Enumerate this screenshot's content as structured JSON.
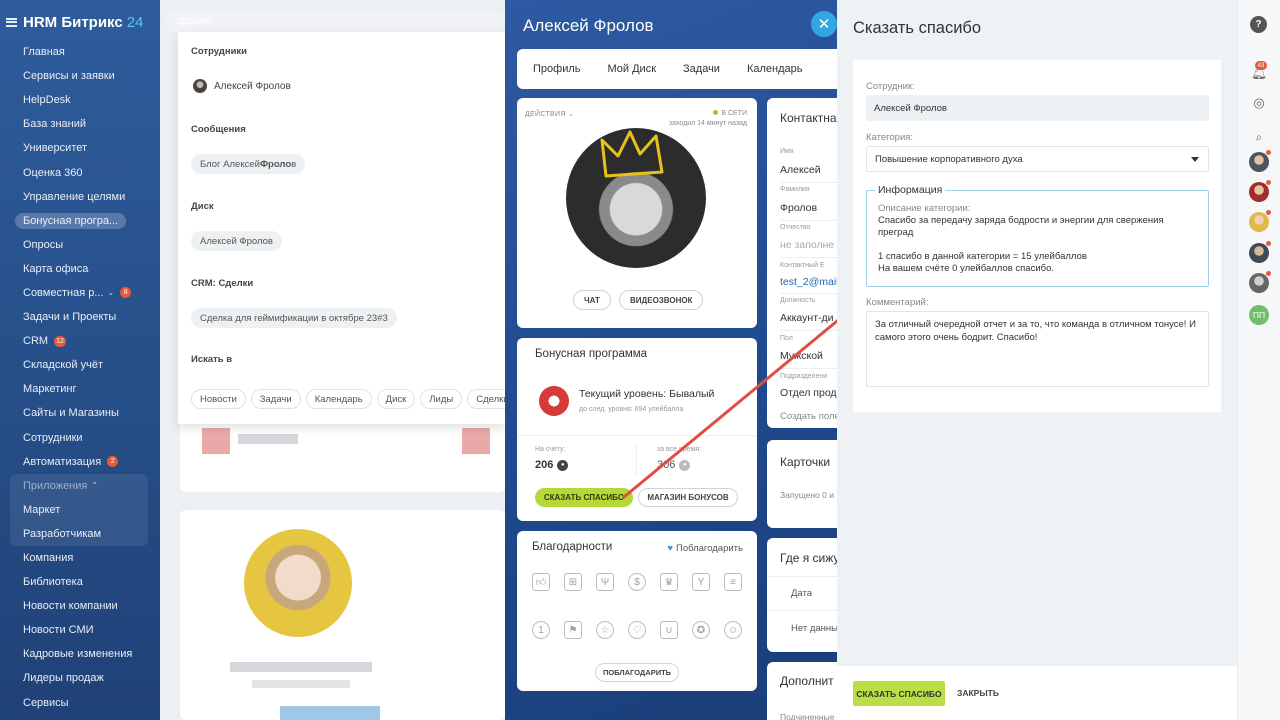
{
  "sidebar": {
    "logo": "HRM Битрикс",
    "logo_num": "24",
    "items": [
      {
        "label": "Главная"
      },
      {
        "label": "Сервисы и заявки"
      },
      {
        "label": "HelpDesk"
      },
      {
        "label": "База знаний"
      },
      {
        "label": "Университет"
      },
      {
        "label": "Оценка 360"
      },
      {
        "label": "Управление целями"
      },
      {
        "label": "Бонусная програ..."
      },
      {
        "label": "Опросы"
      },
      {
        "label": "Карта офиса"
      },
      {
        "label": "Совместная р...",
        "badge": "8"
      },
      {
        "label": "Задачи и Проекты"
      },
      {
        "label": "CRM",
        "badge": "12"
      },
      {
        "label": "Складской учёт"
      },
      {
        "label": "Маркетинг"
      },
      {
        "label": "Сайты и Магазины"
      },
      {
        "label": "Сотрудники"
      },
      {
        "label": "Автоматизация",
        "badge": "2"
      }
    ],
    "apps": {
      "label": "Приложения",
      "items": [
        "Маркет",
        "Разработчикам"
      ]
    },
    "items2": [
      "Компания",
      "Библиотека",
      "Новости компании",
      "Новости СМИ",
      "Кадровые изменения",
      "Лидеры продаж",
      "Сервисы"
    ]
  },
  "search": {
    "query": "фроло",
    "sec_employees": "Сотрудники",
    "employee": "Алексей Фролов",
    "sec_messages": "Сообщения",
    "blog_prefix": "Блог Алексей ",
    "blog_bold": "Фроло",
    "blog_suffix": "в",
    "sec_disk": "Диск",
    "disk_item": "Алексей Фролов",
    "sec_crm": "CRM: Сделки",
    "crm_item": "Сделка для геймификации в октябре 23#3",
    "sec_search_in": "Искать в",
    "scopes": [
      "Новости",
      "Задачи",
      "Календарь",
      "Диск",
      "Лиды",
      "Сделки"
    ]
  },
  "profile": {
    "name": "Алексей Фролов",
    "tabs": [
      "Профиль",
      "Мой Диск",
      "Задачи",
      "Календарь"
    ],
    "actions_label": "ДЕЙСТВИЯ",
    "online": "В СЕТИ",
    "last_seen": "заходил 14 минут назад",
    "chat_btn": "ЧАТ",
    "video_btn": "ВИДЕОЗВОНОК",
    "bonus": {
      "title": "Бонусная программа",
      "level": "Текущий уровень: Бывалый",
      "next": "до след. уровня: 694 улейбалла",
      "account_label": "На счету:",
      "account_value": "206",
      "total_label": "за все время:",
      "total_value": "306",
      "thanks_btn": "СКАЗАТЬ СПАСИБО",
      "shop_btn": "МАГАЗИН БОНУСОВ"
    },
    "gratitude": {
      "title": "Благодарности",
      "link": "Поблагодарить",
      "btn": "ПОБЛАГОДАРИТЬ",
      "icons": [
        "thumbs-up",
        "gift",
        "trophy",
        "money-bag",
        "crown",
        "cocktail",
        "cake",
        "one-circle",
        "flag",
        "star",
        "heart",
        "beer",
        "medal",
        "smile"
      ]
    },
    "contacts": {
      "title": "Контактна",
      "name_label": "Имя",
      "name_value": "Алексей",
      "surname_label": "Фамилия",
      "surname_value": "Фролов",
      "patronymic_label": "Отчество",
      "patronymic_value": "не заполне",
      "email_label": "Контактный E",
      "email_value": "test_2@mail.",
      "position_label": "Должность",
      "position_value": "Аккаунт-ди",
      "gender_label": "Пол",
      "gender_value": "Мужской",
      "dept_label": "Подразделени",
      "dept_value": "Отдел прода",
      "create_field": "Создать поле"
    },
    "cards": {
      "title": "Карточки",
      "text": "Запущено 0 и"
    },
    "where": {
      "title": "Где я сижу",
      "col_date": "Дата",
      "no_data": "Нет данны"
    },
    "extra": {
      "title": "Дополнит",
      "sub": "Подчиненные"
    }
  },
  "thanks_form": {
    "title": "Сказать спасибо",
    "employee_label": "Сотрудник:",
    "employee_value": "Алексей Фролов",
    "category_label": "Категория:",
    "category_value": "Повышение корпоративного духа",
    "info_title": "Информация",
    "desc_label": "Описание категории:",
    "desc_text": "Спасибо за передачу заряда бодрости и энергии для свержения преград",
    "rate": "1 спасибо в данной категории = 15 улейбаллов",
    "balance": "На вашем счёте 0 улейбаллов спасибо.",
    "comment_label": "Комментарий:",
    "comment_value": "За отличный очередной отчет и за то, что команда в отличном тонусе! И самого этого очень бодрит. Спасибо!",
    "submit": "СКАЗАТЬ СПАСИБО",
    "close": "ЗАКРЫТЬ"
  },
  "rail": {
    "help": "?",
    "notif_count": "43",
    "pp_initials": "ПП"
  },
  "colors": {
    "sidebar": "#2e5c9b",
    "accent_green": "#bbdd46",
    "close_blue": "#33a7e3",
    "badge_red": "#e25b3a",
    "arrow": "#e04c44"
  }
}
